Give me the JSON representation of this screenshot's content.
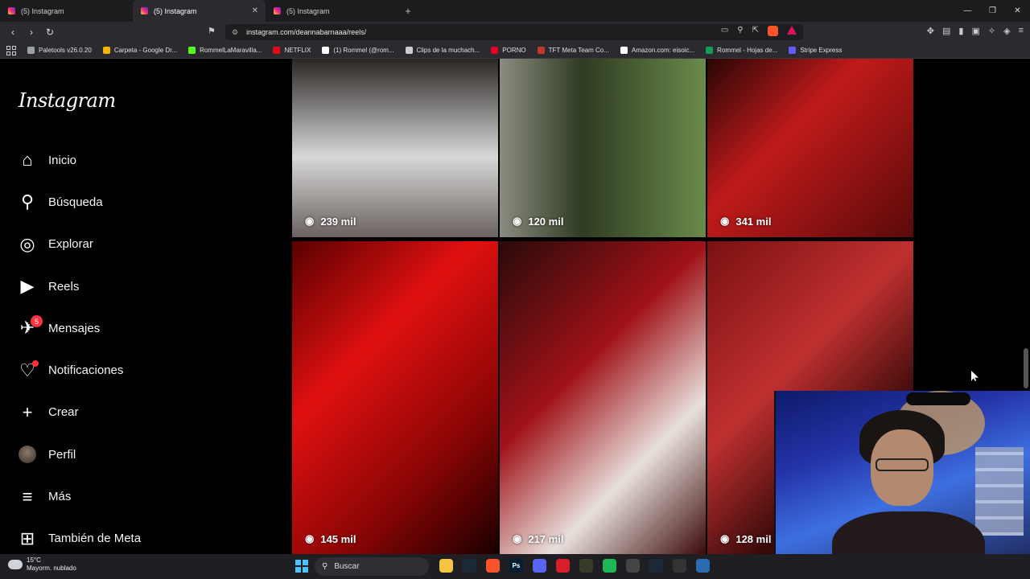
{
  "browser": {
    "tabs": [
      {
        "label": "(5) Instagram",
        "active": false
      },
      {
        "label": "(5) Instagram",
        "active": true
      },
      {
        "label": "(5) Instagram",
        "active": false
      }
    ],
    "url": "instagram.com/deannabarnaaa/reels/",
    "bookmarks": [
      {
        "label": "Paletools v26.0.20",
        "color": "#9aa0a6"
      },
      {
        "label": "Carpeta - Google Dr...",
        "color": "#f4b400"
      },
      {
        "label": "RommelLaMaravilla...",
        "color": "#53fc18"
      },
      {
        "label": "NETFLIX",
        "color": "#e50914"
      },
      {
        "label": "(1) Rommel (@rom...",
        "color": "#ffffff"
      },
      {
        "label": "Clips de la muchach...",
        "color": "#cccccc"
      },
      {
        "label": "PORNO",
        "color": "#e60023"
      },
      {
        "label": "TFT Meta Team Co...",
        "color": "#c0392b"
      },
      {
        "label": "Amazon.com: eisoic...",
        "color": "#ffffff"
      },
      {
        "label": "Rommel - Hojas de...",
        "color": "#0f9d58"
      },
      {
        "label": "Stripe Express",
        "color": "#635bff"
      }
    ]
  },
  "sidebar": {
    "logo": "Instagram",
    "items": [
      {
        "label": "Inicio",
        "icon": "home-icon",
        "glyph": "⌂"
      },
      {
        "label": "Búsqueda",
        "icon": "search-icon",
        "glyph": "⚲"
      },
      {
        "label": "Explorar",
        "icon": "compass-icon",
        "glyph": "◎"
      },
      {
        "label": "Reels",
        "icon": "reels-icon",
        "glyph": "▶"
      },
      {
        "label": "Mensajes",
        "icon": "messenger-icon",
        "glyph": "✈",
        "badge": "5"
      },
      {
        "label": "Notificaciones",
        "icon": "heart-icon",
        "glyph": "♡",
        "dot": true
      },
      {
        "label": "Crear",
        "icon": "plus-icon",
        "glyph": "+"
      },
      {
        "label": "Perfil",
        "icon": "avatar",
        "glyph": ""
      },
      {
        "label": "Más",
        "icon": "menu-icon",
        "glyph": "≡"
      },
      {
        "label": "También de Meta",
        "icon": "meta-apps-icon",
        "glyph": "⊞"
      }
    ]
  },
  "reels": [
    {
      "views": "239 mil",
      "bg": "linear-gradient(180deg,#2a2624 0%,#d8d8d8 55%,#6a625e 100%)"
    },
    {
      "views": "120 mil",
      "bg": "linear-gradient(90deg,#8a8c80 0%,#2f3b22 40%,#6a8a4a 100%)"
    },
    {
      "views": "341 mil",
      "bg": "linear-gradient(135deg,#2a0606 0%,#c01a1a 40%,#5a0a0a 100%)"
    },
    {
      "views": "145 mil",
      "bg": "linear-gradient(135deg,#5a0000 0%,#e01010 35%,#8a0505 70%,#1a0000 100%)"
    },
    {
      "views": "217 mil",
      "bg": "linear-gradient(135deg,#2a0a0a 0%,#a01218 40%,#e8e0dc 70%,#3a0808 100%)"
    },
    {
      "views": "128 mil",
      "bg": "linear-gradient(135deg,#7a1010 0%,#c03030 40%,#3a0a0a 70%,#0a0a0a 100%)"
    }
  ],
  "taskbar": {
    "temperature": "15°C",
    "weather": "Mayorm. nublado",
    "search_placeholder": "Buscar",
    "apps": [
      {
        "name": "file-explorer-icon",
        "color": "#f5c542",
        "text": ""
      },
      {
        "name": "steam-icon",
        "color": "#1b2838",
        "text": ""
      },
      {
        "name": "brave-icon",
        "color": "#fb542b",
        "text": ""
      },
      {
        "name": "photoshop-icon",
        "color": "#001e36",
        "text": "Ps"
      },
      {
        "name": "discord-icon",
        "color": "#5865f2",
        "text": ""
      },
      {
        "name": "opera-icon",
        "color": "#d81e2a",
        "text": ""
      },
      {
        "name": "pencil-app-icon",
        "color": "#3a3a2a",
        "text": ""
      },
      {
        "name": "spotify-icon",
        "color": "#1db954",
        "text": ""
      },
      {
        "name": "valorant-icon",
        "color": "#444",
        "text": ""
      },
      {
        "name": "steam2-icon",
        "color": "#1b2838",
        "text": ""
      },
      {
        "name": "obs-icon",
        "color": "#333",
        "text": ""
      },
      {
        "name": "app-icon",
        "color": "#2b6cb0",
        "text": ""
      }
    ]
  }
}
